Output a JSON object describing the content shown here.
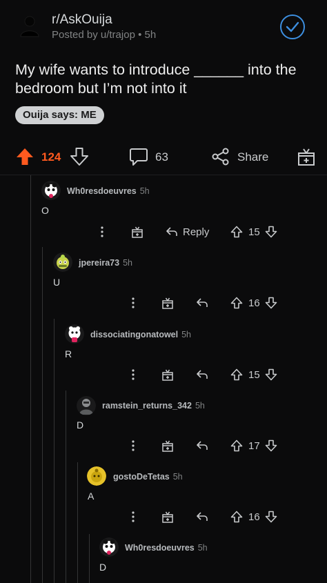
{
  "post": {
    "subreddit": "r/AskOuija",
    "posted_by": "Posted by u/trajop",
    "time_ago": "5h",
    "dot": "•",
    "title": "My wife wants to introduce ______ into the bedroom but I’m not into it",
    "flair": "Ouija says: ME",
    "score": "124",
    "comment_count": "63",
    "share_label": "Share"
  },
  "colors": {
    "upvote_active": "#ff5a1f",
    "joined_check": "#3d8fe0",
    "thread_line": "#343536"
  },
  "comments": [
    {
      "user": "Wh0resdoeuvres",
      "time": "5h",
      "body": "O",
      "score": "15",
      "reply_label": "Reply",
      "avatar": "snoo-panda"
    },
    {
      "user": "jpereira73",
      "time": "5h",
      "body": "U",
      "score": "16",
      "reply_label": "",
      "avatar": "snoo-green"
    },
    {
      "user": "dissociatingonatowel",
      "time": "5h",
      "body": "R",
      "score": "15",
      "reply_label": "",
      "avatar": "snoo-pink"
    },
    {
      "user": "ramstein_returns_342",
      "time": "5h",
      "body": "D",
      "score": "17",
      "reply_label": "",
      "avatar": "snoo-dark"
    },
    {
      "user": "gostoDeTetas",
      "time": "5h",
      "body": "A",
      "score": "16",
      "reply_label": "",
      "avatar": "snoo-yellow"
    },
    {
      "user": "Wh0resdoeuvres",
      "time": "5h",
      "body": "D",
      "score": "",
      "reply_label": "",
      "avatar": "snoo-panda"
    }
  ]
}
